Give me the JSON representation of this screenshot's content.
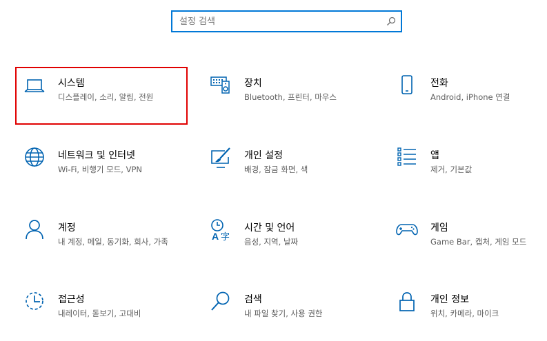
{
  "search": {
    "placeholder": "설정 검색"
  },
  "tiles": [
    {
      "title": "시스템",
      "desc": "디스플레이, 소리, 알림, 전원",
      "icon": "laptop-icon",
      "selected": true
    },
    {
      "title": "장치",
      "desc": "Bluetooth, 프린터, 마우스",
      "icon": "devices-icon"
    },
    {
      "title": "전화",
      "desc": "Android, iPhone 연결",
      "icon": "phone-icon"
    },
    {
      "title": "네트워크 및 인터넷",
      "desc": "Wi-Fi, 비행기 모드, VPN",
      "icon": "globe-icon"
    },
    {
      "title": "개인 설정",
      "desc": "배경, 잠금 화면, 색",
      "icon": "paint-icon"
    },
    {
      "title": "앱",
      "desc": "제거, 기본값",
      "icon": "apps-list-icon"
    },
    {
      "title": "계정",
      "desc": "내 계정, 메일, 동기화, 회사, 가족",
      "icon": "person-icon"
    },
    {
      "title": "시간 및 언어",
      "desc": "음성, 지역, 날짜",
      "icon": "time-language-icon"
    },
    {
      "title": "게임",
      "desc": "Game Bar, 캡처, 게임 모드",
      "icon": "gamepad-icon"
    },
    {
      "title": "접근성",
      "desc": "내레이터, 돋보기, 고대비",
      "icon": "ease-of-access-icon"
    },
    {
      "title": "검색",
      "desc": "내 파일 찾기, 사용 권한",
      "icon": "search-icon"
    },
    {
      "title": "개인 정보",
      "desc": "위치, 카메라, 마이크",
      "icon": "lock-icon"
    }
  ]
}
